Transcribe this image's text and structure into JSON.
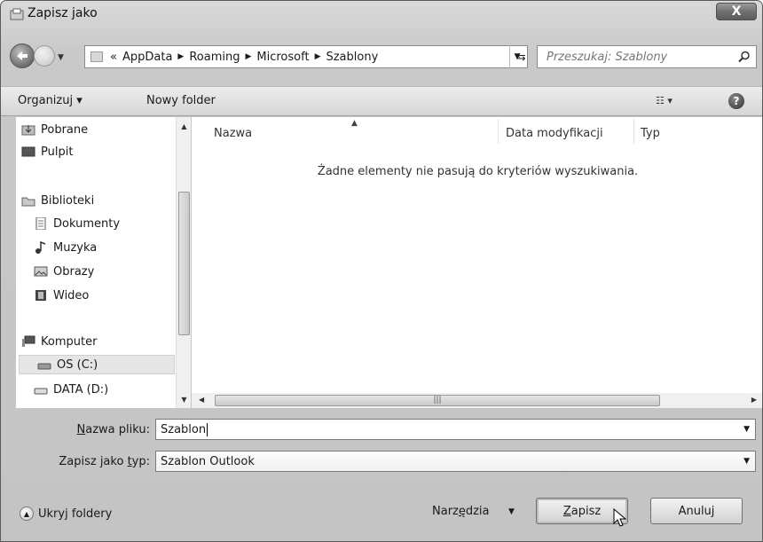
{
  "window": {
    "title": "Zapisz jako",
    "close_glyph": "X"
  },
  "nav": {
    "breadcrumb_prefix": "«",
    "breadcrumbs": [
      "AppData",
      "Roaming",
      "Microsoft",
      "Szablony"
    ],
    "separator": "▶",
    "search_placeholder": "Przeszukaj: Szablony"
  },
  "toolbar": {
    "organize": "Organizuj ▾",
    "new_folder": "Nowy folder",
    "view_glyph": "☷ ▾",
    "help_glyph": "?"
  },
  "sidebar": {
    "items": [
      {
        "label": "Pobrane",
        "icon": "download-folder-icon"
      },
      {
        "label": "Pulpit",
        "icon": "desktop-icon"
      },
      {
        "label": "Biblioteki",
        "icon": "libraries-icon"
      },
      {
        "label": "Dokumenty",
        "icon": "documents-icon"
      },
      {
        "label": "Muzyka",
        "icon": "music-icon"
      },
      {
        "label": "Obrazy",
        "icon": "pictures-icon"
      },
      {
        "label": "Wideo",
        "icon": "video-icon"
      },
      {
        "label": "Komputer",
        "icon": "computer-icon"
      },
      {
        "label": "OS (C:)",
        "icon": "drive-icon"
      },
      {
        "label": "DATA (D:)",
        "icon": "drive-icon"
      }
    ]
  },
  "filelist": {
    "columns": {
      "name": "Nazwa",
      "modified": "Data modyfikacji",
      "type": "Typ"
    },
    "empty_message": "Żadne elementy nie pasują do kryteriów wyszukiwania."
  },
  "form": {
    "filename_label_pre": "N",
    "filename_label_rest": "azwa pliku:",
    "filename_value": "Szablon",
    "type_label_pre": "Zapisz jako ",
    "type_label_u": "t",
    "type_label_rest": "yp:",
    "type_value": "Szablon Outlook"
  },
  "footer": {
    "hide_folders": "Ukryj foldery",
    "tools_pre": "Narz",
    "tools_u": "ę",
    "tools_rest": "dzia",
    "save_u": "Z",
    "save_rest": "apisz",
    "cancel": "Anuluj"
  }
}
